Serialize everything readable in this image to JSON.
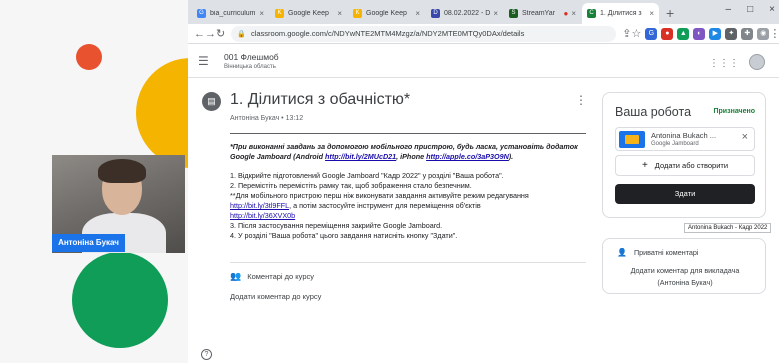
{
  "meeting": {
    "participant_name": "Антоніна Букач"
  },
  "browser": {
    "tabs": [
      {
        "title": "bia_curriculum",
        "favicon_color": "#4285f4",
        "favicon_glyph": "G"
      },
      {
        "title": "Google Keep",
        "favicon_color": "#f6b400",
        "favicon_glyph": "K"
      },
      {
        "title": "Google Keep",
        "favicon_color": "#f6b400",
        "favicon_glyph": "K"
      },
      {
        "title": "08.02.2022 - D",
        "favicon_color": "#3949ab",
        "favicon_glyph": "D"
      },
      {
        "title": "StreamYar",
        "favicon_color": "#1b5e20",
        "favicon_glyph": "S"
      },
      {
        "title": "1. Ділитися з",
        "favicon_color": "#188038",
        "favicon_glyph": "C",
        "active": true
      }
    ],
    "url": "classroom.google.com/c/NDYwNTE2MTM4Mzgz/a/NDY2MTE0MTQy0DAx/details"
  },
  "classroom": {
    "class_name": "001 Флешмоб",
    "class_region": "Вінницька область"
  },
  "assignment": {
    "title": "1. Ділитися з обачністю*",
    "author": "Антоніна Букач",
    "time": "13:12",
    "note_prefix": "*При виконанні завдань за допомогою мобільного пристрою, будь ласка, установіть додаток Google Jamboard (Android ",
    "android_link": "http://bit.ly/2MUcD21",
    "note_mid": ", iPhone ",
    "iphone_link": "http://apple.co/3aP3O9N",
    "note_end": ").",
    "step1": "1. Відкрийте підготовлений Google Jamboard \"Кадр 2022\" у розділі \"Ваша робота\".",
    "step2": "2. Перемістіть перемістіть рамку так, щоб зображення стало безпечним.",
    "mobile_note": "**Для мобільного пристрою перш ніж виконувати завдання активуйте режим редагування",
    "link1": "http://bit.ly/3tl9FFL",
    "link1_tail": ", а потім застосуйте інструмент для переміщення об'єктів",
    "link2": "http://bit.ly/36XVX0b",
    "step3": "3. Після застосування переміщення закрийте Google Jamboard.",
    "step4": "4. У розділі \"Ваша робота\" цього завдання натисніть кнопку \"Здати\".",
    "class_comments_label": "Коментарі до курсу",
    "add_class_comment": "Додати коментар до курсу"
  },
  "your_work": {
    "title": "Ваша робота",
    "status": "Призначено",
    "status_color": "#188038",
    "attachment_name": "Antonina Bukach ...",
    "attachment_type": "Google Jamboard",
    "tooltip": "Antonina Bukach - Кадр 2022",
    "add_or_create": "Додати або створити",
    "submit": "Здати"
  },
  "private_comments": {
    "title": "Приватні коментарі",
    "add_line1": "Додати коментар для викладача",
    "add_line2": "(Антоніна Букач)"
  }
}
